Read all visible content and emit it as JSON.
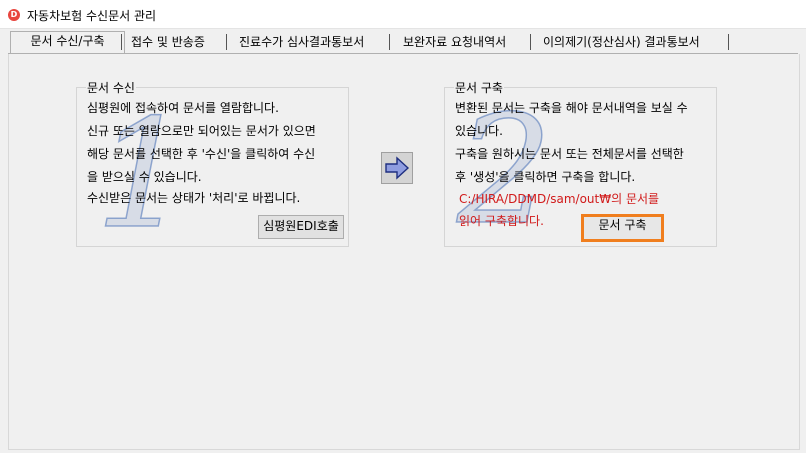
{
  "window": {
    "title": "자동차보험 수신문서 관리",
    "icon_label": "D"
  },
  "tabs": [
    {
      "label": "문서 수신/구축"
    },
    {
      "label": "접수 및 반송증"
    },
    {
      "label": "진료수가 심사결과통보서"
    },
    {
      "label": "보완자료 요청내역서"
    },
    {
      "label": "이의제기(정산심사) 결과통보서"
    }
  ],
  "receive": {
    "title": "문서 수신",
    "big_number": "1",
    "lines": [
      "심평원에 접속하여 문서를 열람합니다.",
      "신규 또는 열람으로만 되어있는 문서가 있으면",
      "해당 문서를 선택한 후 '수신'을 클릭하여 수신",
      "을 받으실 수 있습니다.",
      "수신받은 문서는 상태가 '처리'로 바뀝니다."
    ],
    "button": "심평원EDI호출"
  },
  "build": {
    "title": "문서 구축",
    "big_number": "2",
    "lines": [
      "변환된 문서는 구축을 해야 문서내역을 보실 수",
      "있습니다.",
      "구축을 원하시는 문서 또는 전체문서를 선택한",
      "후 '생성'을 클릭하면 구축을 합니다."
    ],
    "path_lines": [
      "C:/HIRA/DDMD/sam/out₩의 문서를",
      "읽어 구축합니다."
    ],
    "button": "문서 구축",
    "highlight_color": "#f07e1e"
  },
  "arrow": {
    "icon": "right-arrow-icon",
    "color": "#8f9de0"
  }
}
